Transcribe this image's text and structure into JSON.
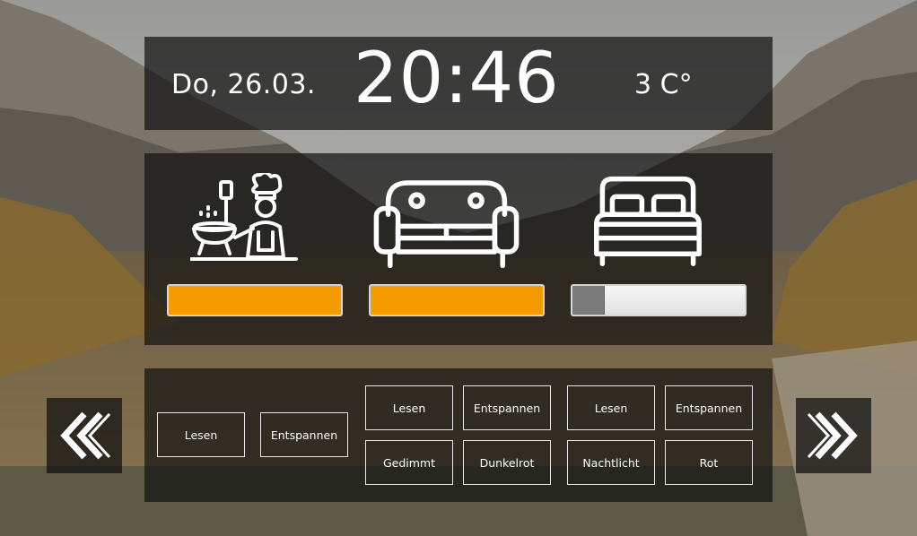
{
  "header": {
    "date": "Do, 26.03.",
    "time": "20:46",
    "temperature": "3 C°"
  },
  "rooms": [
    {
      "name": "kitchen",
      "icon": "chef-cooking-icon",
      "level": 1.0,
      "color": "#f59b00"
    },
    {
      "name": "living-room",
      "icon": "sofa-icon",
      "level": 1.0,
      "color": "#f59b00"
    },
    {
      "name": "bedroom",
      "icon": "bed-icon",
      "level": 0.18,
      "color": "#7a7a7a"
    }
  ],
  "scenes": {
    "group1": [
      "Lesen",
      "Entspannen"
    ],
    "group2": [
      "Lesen",
      "Entspannen",
      "Gedimmt",
      "Dunkelrot"
    ],
    "group3": [
      "Lesen",
      "Entspannen",
      "Nachtlicht",
      "Rot"
    ]
  },
  "nav": {
    "left_icon": "double-chevron-left-icon",
    "right_icon": "double-chevron-right-icon"
  },
  "colors": {
    "accent": "#f59b00",
    "panel": "rgba(20,20,20,0.72)"
  }
}
